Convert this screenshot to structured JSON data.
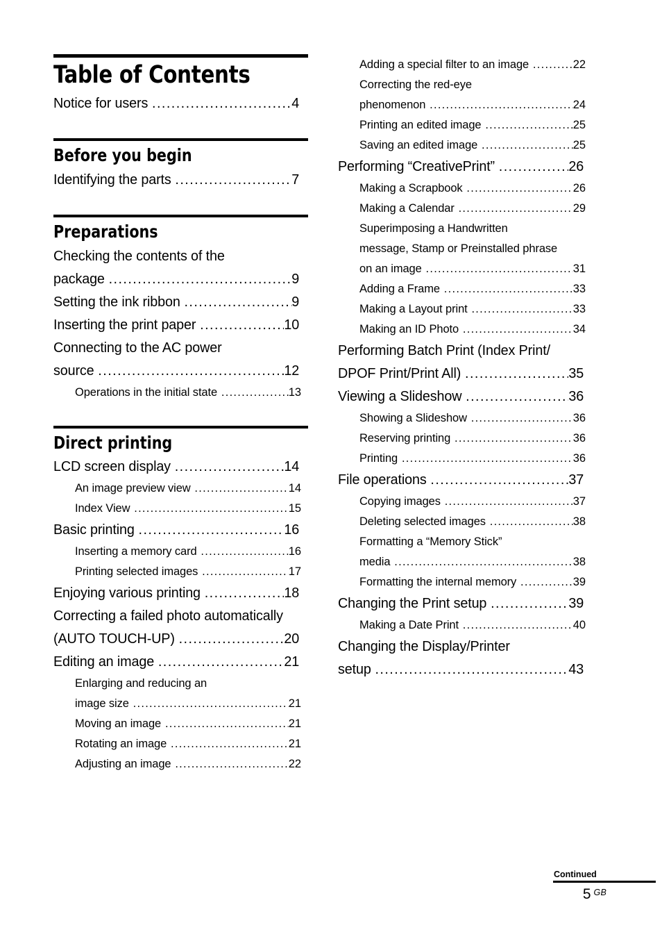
{
  "document": {
    "title": "Table of Contents",
    "language_code": "GB",
    "page_number": "5",
    "footer_note": "Continued"
  },
  "columns": [
    {
      "name": "left-column",
      "blocks": [
        {
          "type": "title",
          "text": "Table of Contents",
          "entries": [
            {
              "level": 1,
              "lines": [
                "Notice for users"
              ],
              "page": "4"
            }
          ]
        },
        {
          "type": "section",
          "text": "Before you begin",
          "entries": [
            {
              "level": 1,
              "lines": [
                "Identifying the parts"
              ],
              "page": "7"
            }
          ]
        },
        {
          "type": "section",
          "text": "Preparations",
          "entries": [
            {
              "level": 1,
              "lines": [
                "Checking the contents of the",
                "package"
              ],
              "page": "9"
            },
            {
              "level": 1,
              "lines": [
                "Setting the ink ribbon"
              ],
              "page": "9"
            },
            {
              "level": 1,
              "lines": [
                "Inserting the print paper"
              ],
              "page": "10"
            },
            {
              "level": 1,
              "lines": [
                "Connecting to the AC power",
                "source"
              ],
              "page": "12"
            },
            {
              "level": 2,
              "lines": [
                "Operations in the initial state"
              ],
              "page": "13"
            }
          ]
        },
        {
          "type": "section",
          "text": "Direct printing",
          "entries": [
            {
              "level": 1,
              "lines": [
                "LCD screen display"
              ],
              "page": "14"
            },
            {
              "level": 2,
              "lines": [
                "An image preview view"
              ],
              "page": "14"
            },
            {
              "level": 2,
              "lines": [
                "Index View"
              ],
              "page": "15"
            },
            {
              "level": 1,
              "lines": [
                "Basic printing"
              ],
              "page": "16"
            },
            {
              "level": 2,
              "lines": [
                "Inserting a memory card"
              ],
              "page": "16"
            },
            {
              "level": 2,
              "lines": [
                "Printing selected images"
              ],
              "page": "17"
            },
            {
              "level": 1,
              "lines": [
                "Enjoying various printing"
              ],
              "page": "18"
            },
            {
              "level": 1,
              "lines": [
                "Correcting a failed photo automatically",
                "(AUTO TOUCH-UP)"
              ],
              "page": "20"
            },
            {
              "level": 1,
              "lines": [
                "Editing an image"
              ],
              "page": "21"
            },
            {
              "level": 2,
              "lines": [
                "Enlarging and reducing an",
                "image size"
              ],
              "page": "21"
            },
            {
              "level": 2,
              "lines": [
                "Moving an image"
              ],
              "page": "21"
            },
            {
              "level": 2,
              "lines": [
                "Rotating an image"
              ],
              "page": "21"
            },
            {
              "level": 2,
              "lines": [
                "Adjusting an image"
              ],
              "page": "22"
            }
          ]
        }
      ]
    },
    {
      "name": "right-column",
      "blocks": [
        {
          "type": "continuation",
          "text": "",
          "entries": [
            {
              "level": 2,
              "lines": [
                "Adding a special filter to an image"
              ],
              "page": "22"
            },
            {
              "level": 2,
              "lines": [
                "Correcting the red-eye",
                "phenomenon"
              ],
              "page": "24"
            },
            {
              "level": 2,
              "lines": [
                "Printing an edited image"
              ],
              "page": "25"
            },
            {
              "level": 2,
              "lines": [
                "Saving an edited image"
              ],
              "page": "25"
            },
            {
              "level": 1,
              "lines": [
                "Performing “CreativePrint”"
              ],
              "page": "26"
            },
            {
              "level": 2,
              "lines": [
                "Making a Scrapbook"
              ],
              "page": "26"
            },
            {
              "level": 2,
              "lines": [
                "Making a Calendar"
              ],
              "page": "29"
            },
            {
              "level": 2,
              "lines": [
                "Superimposing a Handwritten",
                "message, Stamp or Preinstalled phrase",
                "on an image"
              ],
              "page": "31"
            },
            {
              "level": 2,
              "lines": [
                "Adding a Frame"
              ],
              "page": "33"
            },
            {
              "level": 2,
              "lines": [
                "Making a Layout print"
              ],
              "page": "33"
            },
            {
              "level": 2,
              "lines": [
                "Making an ID Photo"
              ],
              "page": "34"
            },
            {
              "level": 1,
              "lines": [
                "Performing Batch Print (Index Print/",
                "DPOF Print/Print All)"
              ],
              "page": "35"
            },
            {
              "level": 1,
              "lines": [
                "Viewing a Slideshow"
              ],
              "page": "36"
            },
            {
              "level": 2,
              "lines": [
                "Showing a Slideshow"
              ],
              "page": "36"
            },
            {
              "level": 2,
              "lines": [
                "Reserving printing"
              ],
              "page": "36"
            },
            {
              "level": 2,
              "lines": [
                "Printing"
              ],
              "page": "36"
            },
            {
              "level": 1,
              "lines": [
                "File operations"
              ],
              "page": "37"
            },
            {
              "level": 2,
              "lines": [
                "Copying images"
              ],
              "page": "37"
            },
            {
              "level": 2,
              "lines": [
                "Deleting selected images"
              ],
              "page": "38"
            },
            {
              "level": 2,
              "lines": [
                "Formatting a “Memory Stick”",
                "media"
              ],
              "page": "38"
            },
            {
              "level": 2,
              "lines": [
                "Formatting the internal memory"
              ],
              "page": "39"
            },
            {
              "level": 1,
              "lines": [
                "Changing the Print setup"
              ],
              "page": "39"
            },
            {
              "level": 2,
              "lines": [
                "Making a Date Print"
              ],
              "page": "40"
            },
            {
              "level": 1,
              "lines": [
                "Changing the Display/Printer",
                "setup"
              ],
              "page": "43"
            }
          ]
        }
      ]
    }
  ]
}
